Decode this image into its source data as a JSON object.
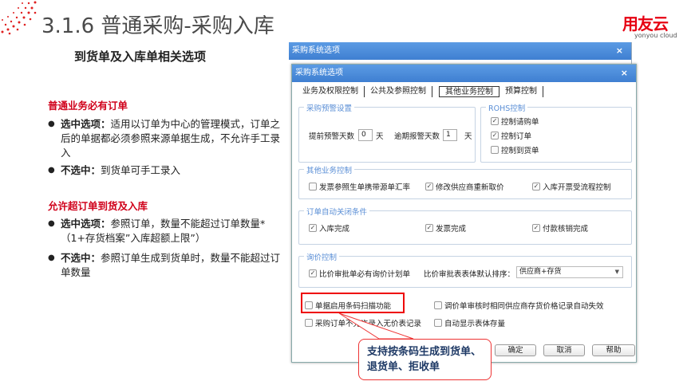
{
  "slide": {
    "title": "3.1.6 普通采购-采购入库",
    "subtitle": "到货单及入库单相关选项",
    "logo": "用友云",
    "logo_sub": "yonyou cloud"
  },
  "left": {
    "sections": [
      {
        "heading": "普通业务必有订单",
        "bullets": [
          {
            "label": "选中选项：",
            "text": "适用以订单为中心的管理模式，订单之后的单据都必须参照来源单据生成，不允许手工录入"
          },
          {
            "label": "不选中：",
            "text": "到货单可手工录入"
          }
        ]
      },
      {
        "heading": "允许超订单到货及入库",
        "bullets": [
          {
            "label": "选中选项：",
            "text": "参照订单，数量不能超过订单数量*（1+存货档案”入库超额上限”）"
          },
          {
            "label": "不选中：",
            "text": "参照订单生成到货单时，数量不能超过订单数量"
          }
        ]
      }
    ]
  },
  "dialog": {
    "back_title": "采购系统选项",
    "title": "采购系统选项",
    "close": "×",
    "tabs": [
      "业务及权限控制",
      "公共及参照控制",
      "其他业务控制",
      "预算控制"
    ],
    "active_tab": 2,
    "warn": {
      "title": "采购预警设置",
      "advance_label": "提前预警天数",
      "advance_value": "0",
      "overdue_label": "逾期报警天数",
      "overdue_value": "1",
      "unit": "天"
    },
    "rohs": {
      "title": "ROHS控制",
      "items": [
        {
          "label": "控制请购单",
          "checked": true
        },
        {
          "label": "控制订单",
          "checked": true
        },
        {
          "label": "控制到货单",
          "checked": false
        }
      ]
    },
    "other": {
      "title": "其他业务控制",
      "items": [
        {
          "label": "发票参照生单携带源单汇率",
          "checked": false
        },
        {
          "label": "修改供应商重新取价",
          "checked": true
        },
        {
          "label": "入库开票受流程控制",
          "checked": true
        }
      ]
    },
    "close_cond": {
      "title": "订单自动关闭条件",
      "items": [
        {
          "label": "入库完成",
          "checked": true
        },
        {
          "label": "发票完成",
          "checked": true
        },
        {
          "label": "付款核销完成",
          "checked": true
        }
      ]
    },
    "price": {
      "title": "询价控制",
      "item": {
        "label": "比价审批单必有询价计划单",
        "checked": true
      },
      "sort_label": "比价审批表表体默认排序：",
      "sort_value": "供应商+存货"
    },
    "misc": [
      {
        "label": "单据启用条码扫描功能",
        "checked": false
      },
      {
        "label": "调价单审核时相同供应商存货价格记录自动失效",
        "checked": false
      },
      {
        "label": "采购订单不允许录入无价表记录",
        "checked": false
      },
      {
        "label": "自动显示表体存量",
        "checked": false
      }
    ],
    "buttons": {
      "ok": "确定",
      "cancel": "取消",
      "help": "帮助"
    }
  },
  "callout": "支持按条码生成到货单、退货单、拒收单",
  "colors": {
    "accent": "#e60012",
    "titlebar": "#4a8ad9"
  }
}
